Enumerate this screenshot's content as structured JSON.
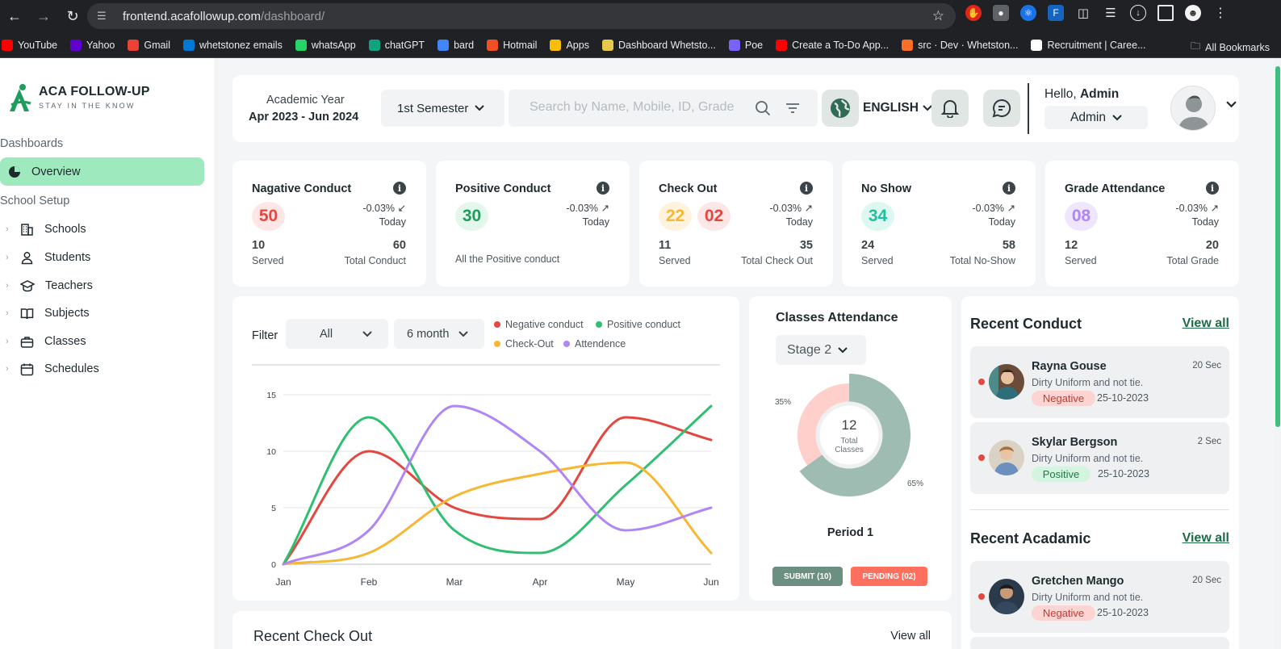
{
  "browser": {
    "url_host": "frontend.acafollowup.com",
    "url_path": "/dashboard/",
    "bookmarks": [
      {
        "label": "YouTube",
        "color": "#ff0000"
      },
      {
        "label": "Yahoo",
        "color": "#6001d2"
      },
      {
        "label": "Gmail",
        "color": "#ea4335"
      },
      {
        "label": "whetstonez emails",
        "color": "#0078d4"
      },
      {
        "label": "whatsApp",
        "color": "#25d366"
      },
      {
        "label": "chatGPT",
        "color": "#10a37f"
      },
      {
        "label": "bard",
        "color": "#4285f4"
      },
      {
        "label": "Hotmail",
        "color": "#f25022"
      },
      {
        "label": "Apps",
        "color": "#fbbc04"
      },
      {
        "label": "Dashboard Whetsto...",
        "color": "#e6c84a"
      },
      {
        "label": "Poe",
        "color": "#7b61ff"
      },
      {
        "label": "Create a To-Do App...",
        "color": "#ff0000"
      },
      {
        "label": "src · Dev · Whetston...",
        "color": "#fc6d26"
      },
      {
        "label": "Recruitment | Caree...",
        "color": "#ffffff"
      }
    ],
    "all_bookmarks": "All Bookmarks"
  },
  "sidebar": {
    "logo_title": "ACA FOLLOW-UP",
    "logo_subtitle": "STAY IN THE KNOW",
    "section_dashboards": "Dashboards",
    "active_item": "Overview",
    "section_setup": "School Setup",
    "items": [
      {
        "label": "Schools",
        "icon": "building-icon"
      },
      {
        "label": "Students",
        "icon": "user-icon"
      },
      {
        "label": "Teachers",
        "icon": "graduation-cap-icon"
      },
      {
        "label": "Subjects",
        "icon": "book-icon"
      },
      {
        "label": "Classes",
        "icon": "briefcase-icon"
      },
      {
        "label": "Schedules",
        "icon": "calendar-icon"
      }
    ]
  },
  "header": {
    "academic_year_label": "Academic Year",
    "academic_year_value": "Apr 2023 - Jun 2024",
    "semester": "1st Semester",
    "search_placeholder": "Search by Name, Mobile, ID, Grade",
    "language": "ENGLISH",
    "hello_prefix": "Hello,",
    "hello_name": "Admin",
    "role": "Admin"
  },
  "stats": [
    {
      "title": "Nagative Conduct",
      "values": [
        "50"
      ],
      "delta": "-0.03%",
      "period": "Today",
      "left_num": "10",
      "left_label": "Served",
      "right_num": "60",
      "right_label": "Total Conduct"
    },
    {
      "title": "Positive Conduct",
      "values": [
        "30"
      ],
      "delta": "-0.03%",
      "period": "Today",
      "note": "All the Positive conduct"
    },
    {
      "title": "Check Out",
      "values": [
        "22",
        "02"
      ],
      "delta": "-0.03%",
      "period": "Today",
      "left_num": "11",
      "left_label": "Served",
      "right_num": "35",
      "right_label": "Total Check Out"
    },
    {
      "title": "No Show",
      "values": [
        "34"
      ],
      "delta": "-0.03%",
      "period": "Today",
      "left_num": "24",
      "left_label": "Served",
      "right_num": "58",
      "right_label": "Total No-Show"
    },
    {
      "title": "Grade Attendance",
      "values": [
        "08"
      ],
      "delta": "-0.03%",
      "period": "Today",
      "left_num": "12",
      "left_label": "Served",
      "right_num": "20",
      "right_label": "Total Grade"
    }
  ],
  "chart_panel": {
    "filter_label": "Filter",
    "filter_value": "All",
    "range_value": "6 month"
  },
  "chart_data": {
    "type": "line",
    "categories": [
      "Jan",
      "Feb",
      "Mar",
      "Apr",
      "May",
      "Jun"
    ],
    "ylim": [
      0,
      15
    ],
    "yticks": [
      0,
      5,
      10,
      15
    ],
    "grid": true,
    "legend_position": "top-right",
    "series": [
      {
        "name": "Negative conduct",
        "color": "#e4473f",
        "values": [
          0,
          10,
          5,
          4,
          13,
          11
        ]
      },
      {
        "name": "Positive conduct",
        "color": "#2fbf71",
        "values": [
          0,
          13,
          3,
          1,
          7,
          14
        ]
      },
      {
        "name": "Check-Out",
        "color": "#f7b733",
        "values": [
          0,
          1,
          6,
          8,
          9,
          1
        ]
      },
      {
        "name": "Attendence",
        "color": "#b085f5",
        "values": [
          0,
          3,
          14,
          10,
          3,
          5
        ]
      }
    ]
  },
  "donut": {
    "title": "Classes Attendance",
    "stage": "Stage 2",
    "center_value": "12",
    "center_label_1": "Total",
    "center_label_2": "Classes",
    "period": "Period 1",
    "submit_label": "SUBMIT (10)",
    "pending_label": "PENDING (02)",
    "colors": {
      "submit": "#6b8f80",
      "pending": "#ff6f5e",
      "ring_main": "#9fbcb2",
      "ring_minor": "#ffcfcb"
    }
  },
  "donut_chart": {
    "type": "pie",
    "segments": [
      {
        "label": "35%",
        "value": 35
      },
      {
        "label": "65%",
        "value": 65
      }
    ]
  },
  "recent_conduct": {
    "title": "Recent Conduct",
    "view_all": "View all",
    "items": [
      {
        "name": "Rayna Gouse",
        "time": "20 Sec",
        "desc": "Dirty Uniform and not tie.",
        "tag": "Negative",
        "date": "25-10-2023"
      },
      {
        "name": "Skylar Bergson",
        "time": "2 Sec",
        "desc": "Dirty Uniform and not tie.",
        "tag": "Positive",
        "date": "25-10-2023"
      }
    ]
  },
  "recent_academic": {
    "title": "Recent Acadamic",
    "view_all": "View all",
    "items": [
      {
        "name": "Gretchen Mango",
        "time": "20 Sec",
        "desc": "Dirty Uniform and not tie.",
        "tag": "Negative",
        "date": "25-10-2023"
      }
    ]
  },
  "recent_checkout": {
    "title": "Recent Check Out",
    "view_all": "View all"
  }
}
